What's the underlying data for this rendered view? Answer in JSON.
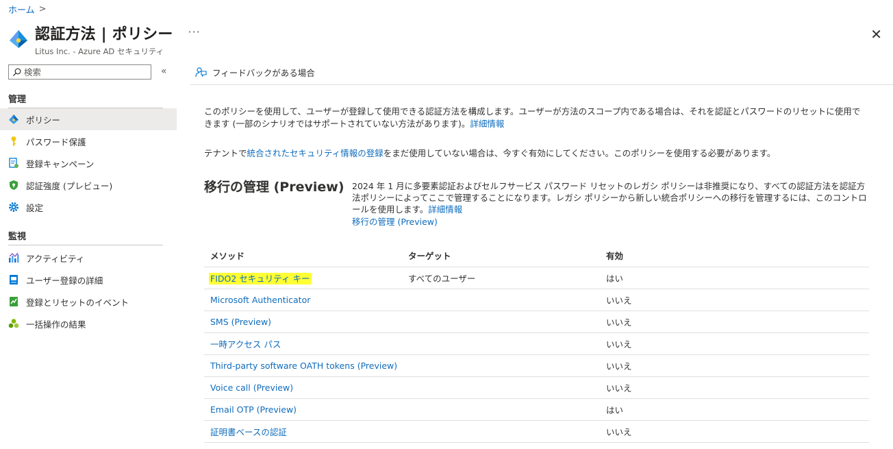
{
  "breadcrumb": {
    "home": "ホーム",
    "separator": ">"
  },
  "header": {
    "title": "認証方法 | ポリシー",
    "subtitle": "Litus Inc. - Azure AD セキュリティ",
    "more": "···",
    "close": "✕"
  },
  "sidebar": {
    "search_placeholder": "検索",
    "collapse": "«",
    "sections": [
      {
        "label": "管理",
        "items": [
          {
            "label": "ポリシー",
            "icon": "policy-icon",
            "active": true
          },
          {
            "label": "パスワード保護",
            "icon": "key-icon"
          },
          {
            "label": "登録キャンペーン",
            "icon": "campaign-icon"
          },
          {
            "label": "認証強度 (プレビュー)",
            "icon": "shield-icon"
          },
          {
            "label": "設定",
            "icon": "gear-icon"
          }
        ]
      },
      {
        "label": "監視",
        "items": [
          {
            "label": "アクティビティ",
            "icon": "activity-chart-icon"
          },
          {
            "label": "ユーザー登録の詳細",
            "icon": "user-details-icon"
          },
          {
            "label": "登録とリセットのイベント",
            "icon": "events-icon"
          },
          {
            "label": "一括操作の結果",
            "icon": "bulk-results-icon"
          }
        ]
      }
    ]
  },
  "toolbar": {
    "feedback": "フィードバックがある場合"
  },
  "intro": {
    "text": "このポリシーを使用して、ユーザーが登録して使用できる認証方法を構成します。ユーザーが方法のスコープ内である場合は、それを認証とパスワードのリセットに使用できます (一部のシナリオではサポートされていない方法があります)。",
    "link": "詳細情報"
  },
  "tenant_note": {
    "prefix": "テナントで",
    "link": "統合されたセキュリティ情報の登録",
    "suffix": "をまだ使用していない場合は、今すぐ有効にしてください。このポリシーを使用する必要があります。"
  },
  "migration": {
    "title": "移行の管理 (Preview)",
    "description": "2024 年 1 月に多要素認証およびセルフサービス パスワード リセットのレガシ ポリシーは非推奨になり、すべての認証方法を認証方法ポリシーによってここで管理することになります。レガシ ポリシーから新しい統合ポリシーへの移行を管理するには、このコントロールを使用します。",
    "desc_link": "詳細情報",
    "manage_link": "移行の管理 (Preview)"
  },
  "table": {
    "headers": [
      "メソッド",
      "ターゲット",
      "有効"
    ],
    "rows": [
      {
        "method": "FIDO2 セキュリティ キー",
        "target": "すべてのユーザー",
        "enabled": "はい",
        "highlighted": true
      },
      {
        "method": "Microsoft Authenticator",
        "target": "",
        "enabled": "いいえ"
      },
      {
        "method": "SMS (Preview)",
        "target": "",
        "enabled": "いいえ"
      },
      {
        "method": "一時アクセス パス",
        "target": "",
        "enabled": "いいえ"
      },
      {
        "method": "Third-party software OATH tokens (Preview)",
        "target": "",
        "enabled": "いいえ"
      },
      {
        "method": "Voice call (Preview)",
        "target": "",
        "enabled": "いいえ"
      },
      {
        "method": "Email OTP (Preview)",
        "target": "",
        "enabled": "はい"
      },
      {
        "method": "証明書ベースの認証",
        "target": "",
        "enabled": "いいえ"
      }
    ]
  },
  "colors": {
    "link": "#0f6cbd",
    "highlight": "#ffff33",
    "active_nav": "#edebe9"
  }
}
